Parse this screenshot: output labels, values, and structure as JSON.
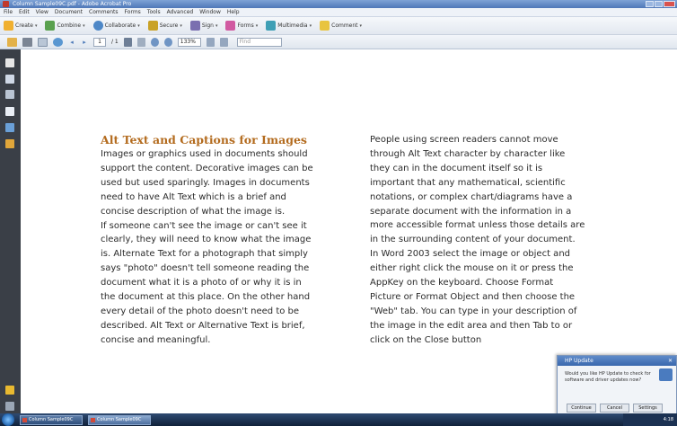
{
  "window": {
    "title": "Column Sample09C.pdf - Adobe Acrobat Pro"
  },
  "menubar": {
    "items": [
      "File",
      "Edit",
      "View",
      "Document",
      "Comments",
      "Forms",
      "Tools",
      "Advanced",
      "Window",
      "Help"
    ]
  },
  "task_toolbar": {
    "items": [
      {
        "label": "Create",
        "icon": "create-icon"
      },
      {
        "label": "Combine",
        "icon": "combine-icon"
      },
      {
        "label": "Collaborate",
        "icon": "collaborate-icon"
      },
      {
        "label": "Secure",
        "icon": "lock-icon"
      },
      {
        "label": "Sign",
        "icon": "pen-icon"
      },
      {
        "label": "Forms",
        "icon": "forms-icon"
      },
      {
        "label": "Multimedia",
        "icon": "film-icon"
      },
      {
        "label": "Comment",
        "icon": "comment-icon"
      }
    ]
  },
  "nav_toolbar": {
    "page_current": "1",
    "page_total": "/ 1",
    "zoom": "133%",
    "find_placeholder": "Find"
  },
  "document": {
    "heading": "Alt Text and Captions for Images",
    "left_lines": [
      "Images or graphics used in documents should",
      "support the content. Decorative images can be",
      "used but used sparingly. Images in documents",
      "need to have Alt Text which is a brief and",
      "concise description of what the image is.",
      "If someone can't see the image or can't see it",
      "clearly, they will need to know what the image",
      "is. Alternate Text for a photograph that simply",
      "says \"photo\" doesn't tell someone reading the",
      "document what it is a photo of or why it is in",
      "the document at this place. On the other hand",
      "every detail of the photo doesn't need to be",
      "described. Alt Text or Alternative Text is brief,",
      "concise and meaningful."
    ],
    "right_lines": [
      "People using screen readers cannot move",
      "through Alt Text character by character like",
      "they can in the document itself so it is",
      "important that any mathematical, scientific",
      "notations, or complex chart/diagrams have a",
      "separate document with the information in a",
      "more accessible format unless those details are",
      "in the surrounding content of your document.",
      "In Word 2003 select the image or object and",
      "either right click the mouse on it or press the",
      "AppKey on the keyboard. Choose Format",
      "Picture or Format Object and then choose the",
      "\"Web\" tab. You can type in your description of",
      "the image in the edit area and then Tab to or",
      "click on the Close button"
    ]
  },
  "popup": {
    "title": "HP Update",
    "message": "Would you like HP Update to check for software and driver updates now?",
    "buttons": [
      "Continue",
      "Cancel",
      "Settings"
    ]
  },
  "taskbar": {
    "buttons": [
      "Column Sample09C",
      "Column Sample09C"
    ],
    "clock": "4:18"
  }
}
